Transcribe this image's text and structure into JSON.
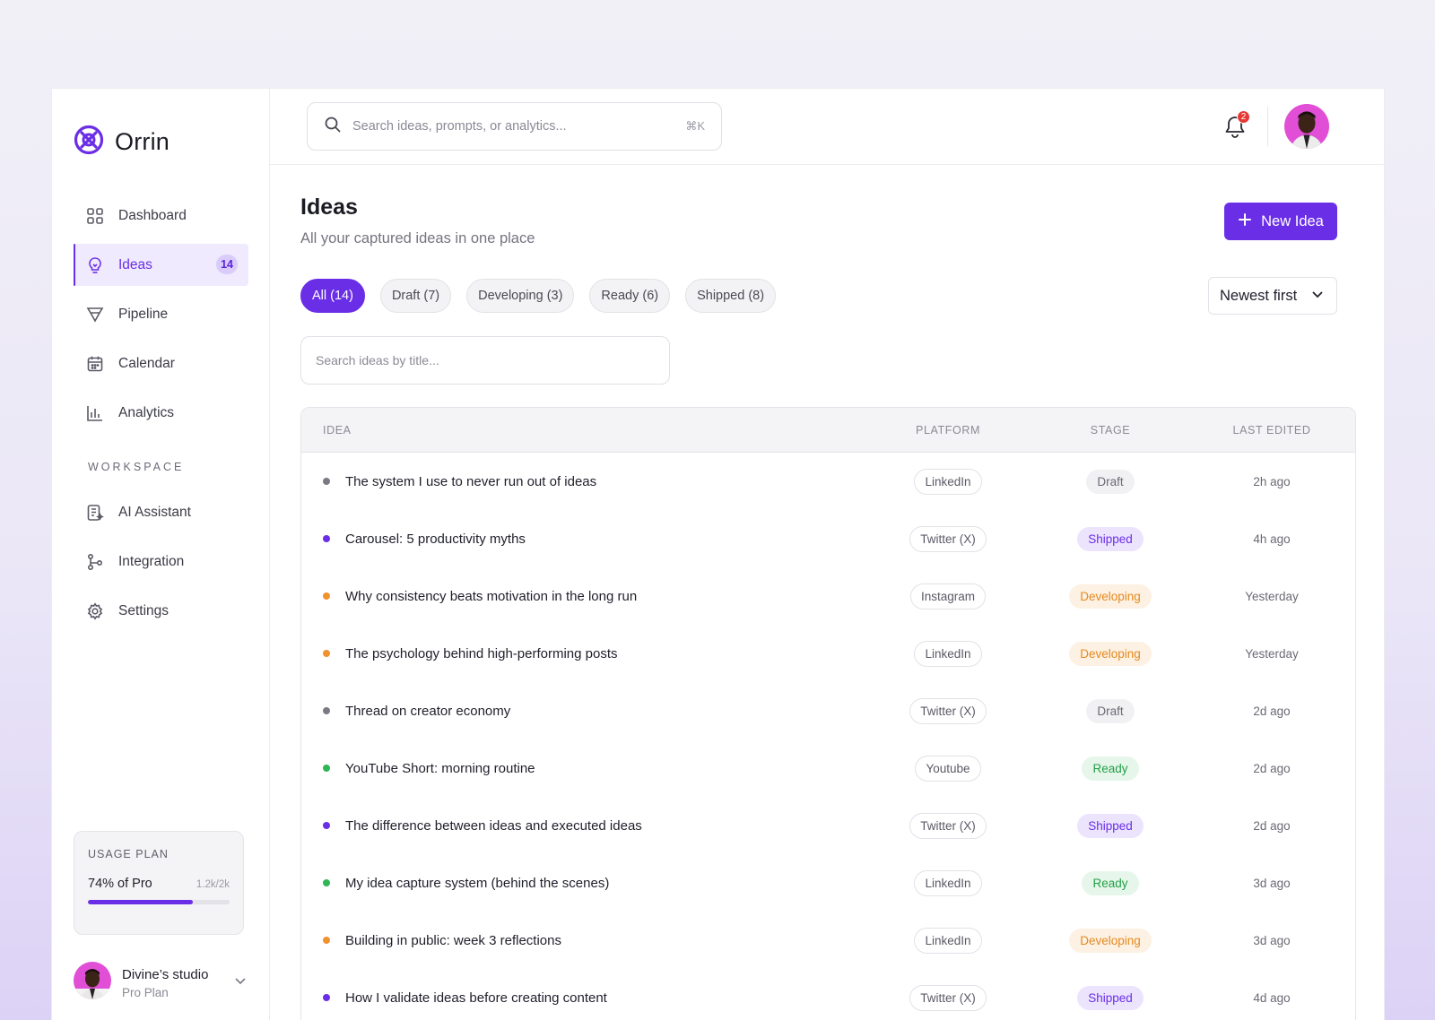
{
  "app": {
    "name": "Orrin"
  },
  "sidebar": {
    "items": [
      {
        "label": "Dashboard",
        "icon": "grid-icon"
      },
      {
        "label": "Ideas",
        "icon": "lightbulb-icon",
        "badge": "14",
        "active": true
      },
      {
        "label": "Pipeline",
        "icon": "funnel-icon"
      },
      {
        "label": "Calendar",
        "icon": "calendar-icon"
      },
      {
        "label": "Analytics",
        "icon": "bar-chart-icon"
      }
    ],
    "workspace_label": "WORKSPACE",
    "workspace_items": [
      {
        "label": "AI Assistant",
        "icon": "document-sparkle-icon"
      },
      {
        "label": "Integration",
        "icon": "git-branch-icon"
      },
      {
        "label": "Settings",
        "icon": "gear-icon"
      }
    ],
    "usage": {
      "title": "USAGE PLAN",
      "label": "74% of Pro",
      "count": "1.2k/2k",
      "progress": 0.74
    },
    "profile": {
      "name": "Divine’s studio",
      "plan": "Pro Plan"
    }
  },
  "header": {
    "search_placeholder": "Search ideas, prompts, or analytics...",
    "shortcut": "⌘K",
    "notification_count": "2"
  },
  "page": {
    "title": "Ideas",
    "subtitle": "All your captured ideas in one place",
    "new_button": "New Idea",
    "filters": [
      "All (14)",
      "Draft (7)",
      "Developing (3)",
      "Ready (6)",
      "Shipped (8)"
    ],
    "active_filter": 0,
    "sort": "Newest first",
    "title_search_placeholder": "Search ideas by title..."
  },
  "table": {
    "columns": [
      "IDEA",
      "PLATFORM",
      "STAGE",
      "LAST EDITED"
    ],
    "rows": [
      {
        "title": "The system I use to never run out of ideas",
        "platform": "LinkedIn",
        "stage": "Draft",
        "edited": "2h ago"
      },
      {
        "title": "Carousel: 5 productivity myths",
        "platform": "Twitter (X)",
        "stage": "Shipped",
        "edited": "4h ago"
      },
      {
        "title": "Why consistency beats motivation in the long run",
        "platform": "Instagram",
        "stage": "Developing",
        "edited": "Yesterday"
      },
      {
        "title": "The psychology behind high-performing posts",
        "platform": "LinkedIn",
        "stage": "Developing",
        "edited": "Yesterday"
      },
      {
        "title": "Thread on creator economy",
        "platform": "Twitter (X)",
        "stage": "Draft",
        "edited": "2d ago"
      },
      {
        "title": "YouTube Short: morning routine",
        "platform": "Youtube",
        "stage": "Ready",
        "edited": "2d ago"
      },
      {
        "title": "The difference between ideas and executed ideas",
        "platform": "Twitter (X)",
        "stage": "Shipped",
        "edited": "2d ago"
      },
      {
        "title": "My idea capture system (behind the scenes)",
        "platform": "LinkedIn",
        "stage": "Ready",
        "edited": "3d ago"
      },
      {
        "title": "Building in public: week 3 reflections",
        "platform": "LinkedIn",
        "stage": "Developing",
        "edited": "3d ago"
      },
      {
        "title": "How I validate ideas before creating content",
        "platform": "Twitter (X)",
        "stage": "Shipped",
        "edited": "4d ago"
      }
    ]
  },
  "colors": {
    "accent": "#6a2ee6",
    "draft": "#7a7a84",
    "shipped": "#6a2ee6",
    "developing": "#f0922e",
    "ready": "#2fb657",
    "notification": "#e53935"
  }
}
